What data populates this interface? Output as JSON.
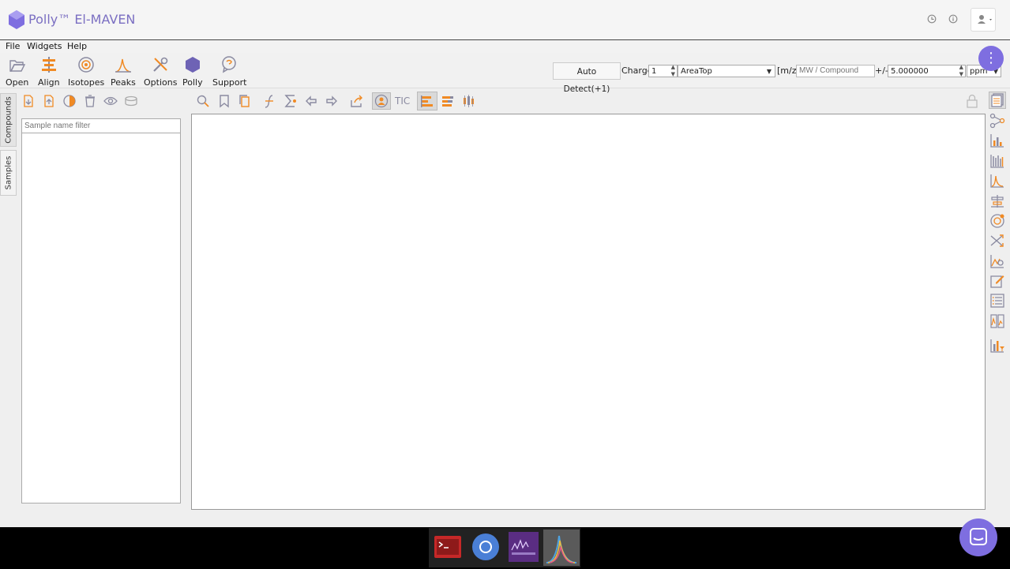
{
  "titlebar": {
    "app_title": "Polly™ El-MAVEN",
    "icons": [
      "history-icon",
      "info-icon",
      "user-icon"
    ]
  },
  "menubar": {
    "items": [
      "File",
      "Widgets",
      "Help"
    ]
  },
  "toolbar": {
    "tools": [
      {
        "label": "Open",
        "icon": "folder-open-icon"
      },
      {
        "label": "Align",
        "icon": "align-icon"
      },
      {
        "label": "Isotopes",
        "icon": "isotopes-icon"
      },
      {
        "label": "Peaks",
        "icon": "peaks-icon"
      },
      {
        "label": "Options",
        "icon": "options-icon"
      },
      {
        "label": "Polly",
        "icon": "polly-icon"
      },
      {
        "label": "Support",
        "icon": "support-icon"
      }
    ],
    "auto_detect_label": "Auto Detect(+1)",
    "charge_label": "Charge",
    "charge_value": "1",
    "quant_type": "AreaTop",
    "mz_label": "[m/z]",
    "mz_placeholder": "MW / Compound",
    "tolerance_label": "+/-",
    "tolerance_value": "5.000000",
    "tolerance_unit": "ppm"
  },
  "left_tabs": {
    "compounds": "Compounds",
    "samples": "Samples"
  },
  "samples": {
    "filter_placeholder": "Sample name filter"
  },
  "plot_toolbar": {
    "tic_label": "TIC"
  },
  "colors": {
    "accent": "#7e6ee0",
    "orange": "#f08a24",
    "icon_gray": "#8a8aa0"
  }
}
